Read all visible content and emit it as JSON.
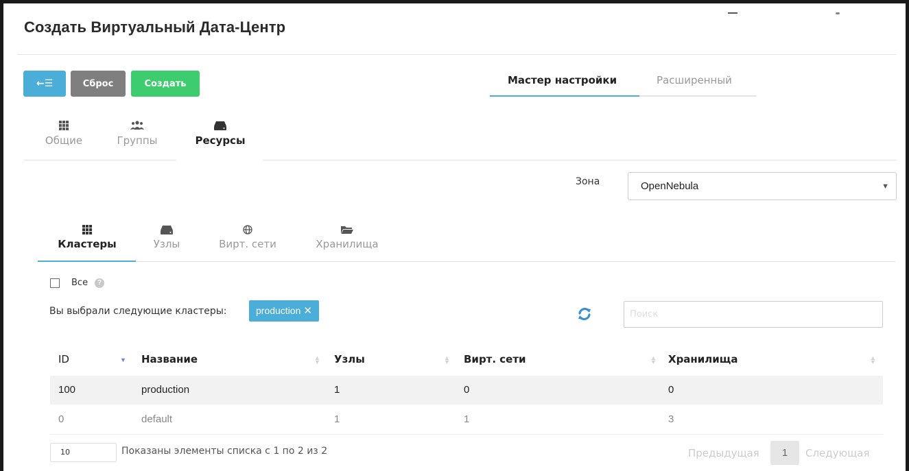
{
  "page": {
    "title": "Создать Виртуальный Дата-Центр"
  },
  "toolbar": {
    "back_label": "←☰",
    "reset_label": "Сброс",
    "create_label": "Создать"
  },
  "mode_tabs": {
    "wizard": "Мастер настройки",
    "advanced": "Расширенный"
  },
  "wizard_tabs": [
    {
      "label": "Общие",
      "icon": "grid-icon"
    },
    {
      "label": "Группы",
      "icon": "users-icon"
    },
    {
      "label": "Ресурсы",
      "icon": "server-icon",
      "active": true
    }
  ],
  "zone": {
    "label": "Зона",
    "value": "OpenNebula"
  },
  "resource_tabs": [
    {
      "label": "Кластеры",
      "icon": "grid-icon",
      "active": true
    },
    {
      "label": "Узлы",
      "icon": "server-icon"
    },
    {
      "label": "Вирт. сети",
      "icon": "globe-icon"
    },
    {
      "label": "Хранилища",
      "icon": "folder-icon"
    }
  ],
  "select_all": {
    "label": "Все",
    "help": "?"
  },
  "selection": {
    "text": "Вы выбрали следующие кластеры:",
    "tag": "production",
    "tag_remove": "✕"
  },
  "search": {
    "placeholder": "Поиск",
    "value": ""
  },
  "table": {
    "columns": [
      "ID",
      "Название",
      "Узлы",
      "Вирт. сети",
      "Хранилища"
    ],
    "rows": [
      {
        "id": "100",
        "name": "production",
        "nodes": "1",
        "vnets": "0",
        "stores": "0"
      },
      {
        "id": "0",
        "name": "default",
        "nodes": "1",
        "vnets": "1",
        "stores": "3"
      }
    ]
  },
  "pagination": {
    "page_size": "10",
    "info": "Показаны элементы списка с 1 по 2 из 2",
    "prev": "Предыдущая",
    "current": "1",
    "next": "Следующая"
  },
  "colors": {
    "accent": "#4aaed9",
    "success": "#3dcc6e",
    "neutral": "#7f7f7f"
  }
}
